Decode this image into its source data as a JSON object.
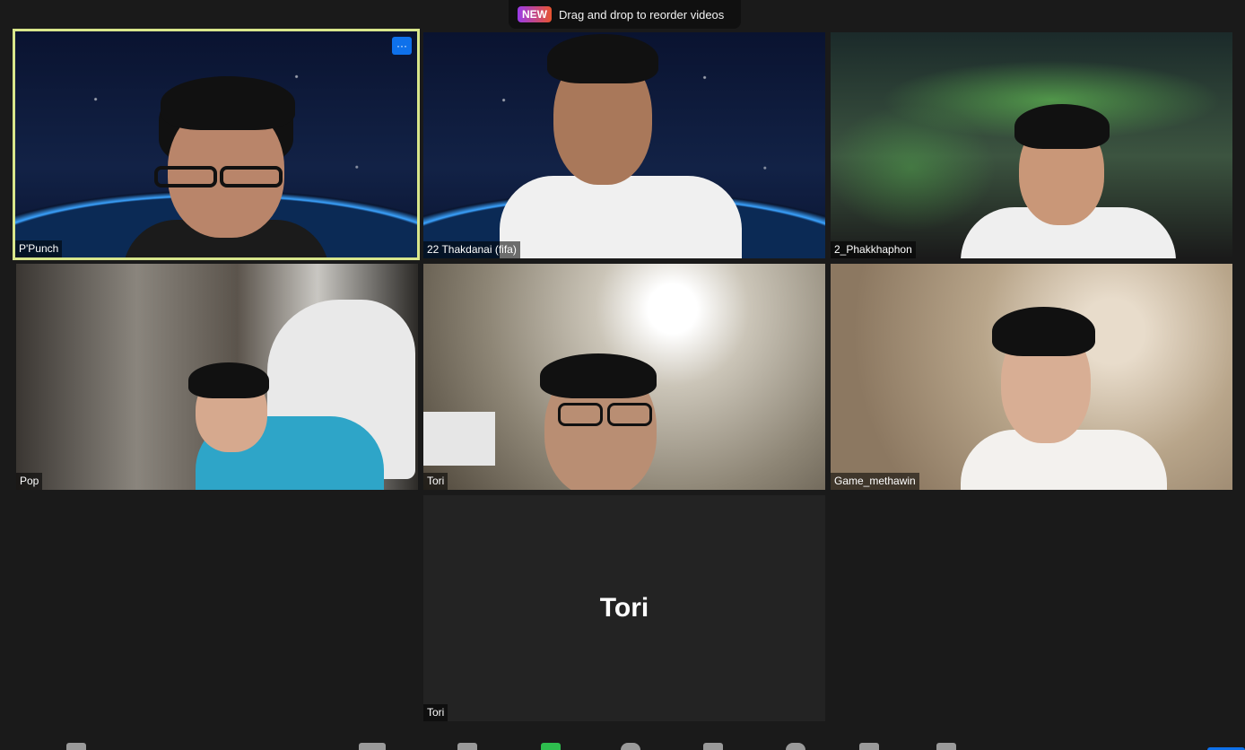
{
  "banner": {
    "badge": "NEW",
    "text": "Drag and drop to reorder videos"
  },
  "tiles": [
    {
      "name": "P'Punch",
      "more": "···"
    },
    {
      "name": "22 Thakdanai (fifa)"
    },
    {
      "name": "2_Phakkhaphon"
    },
    {
      "name": "Pop"
    },
    {
      "name": "Tori"
    },
    {
      "name": "Game_methawin"
    },
    {
      "name": "Tori",
      "center_name": "Tori"
    }
  ],
  "colors": {
    "active_border": "#d8e68b",
    "more_button": "#0e71eb"
  }
}
